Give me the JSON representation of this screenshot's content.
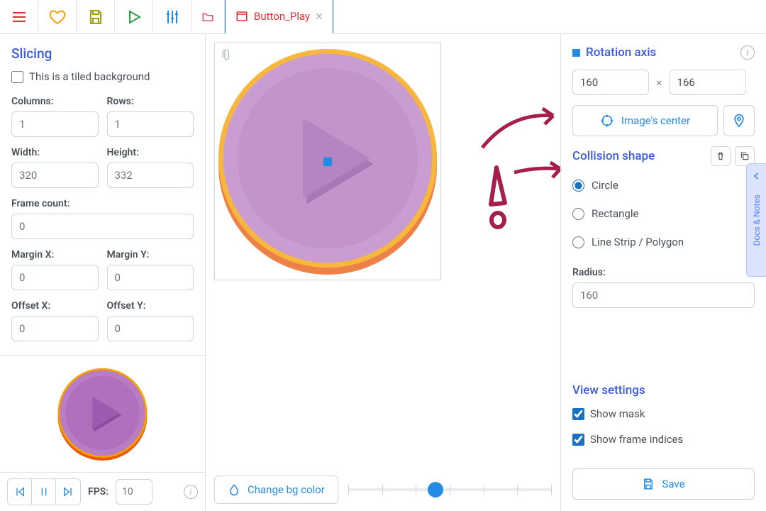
{
  "toolbar": {
    "tab_inactive_icon": "folder",
    "tab_active": "Button_Play"
  },
  "slicing": {
    "heading": "Slicing",
    "tiled_label": "This is a tiled background",
    "tiled_checked": false,
    "columns_label": "Columns:",
    "columns": "1",
    "rows_label": "Rows:",
    "rows": "1",
    "width_label": "Width:",
    "width": "320",
    "height_label": "Height:",
    "height": "332",
    "frame_count_label": "Frame count:",
    "frame_count": "0",
    "margin_x_label": "Margin X:",
    "margin_x": "0",
    "margin_y_label": "Margin Y:",
    "margin_y": "0",
    "offset_x_label": "Offset X:",
    "offset_x": "0",
    "offset_y_label": "Offset Y:",
    "offset_y": "0"
  },
  "playback": {
    "fps_label": "FPS:",
    "fps": "10"
  },
  "center": {
    "bg_button": "Change bg color"
  },
  "right": {
    "rotation_heading": "Rotation axis",
    "rot_x": "160",
    "rot_y": "166",
    "center_button": "Image's center",
    "collision_heading": "Collision shape",
    "shapes": {
      "circle": "Circle",
      "rectangle": "Rectangle",
      "linestrip": "Line Strip / Polygon"
    },
    "selected_shape": "circle",
    "radius_label": "Radius:",
    "radius": "160",
    "view_heading": "View settings",
    "show_mask_label": "Show mask",
    "show_mask": true,
    "show_indices_label": "Show frame indices",
    "show_indices": true,
    "save": "Save"
  },
  "docs_tab": "Docs & Notes"
}
